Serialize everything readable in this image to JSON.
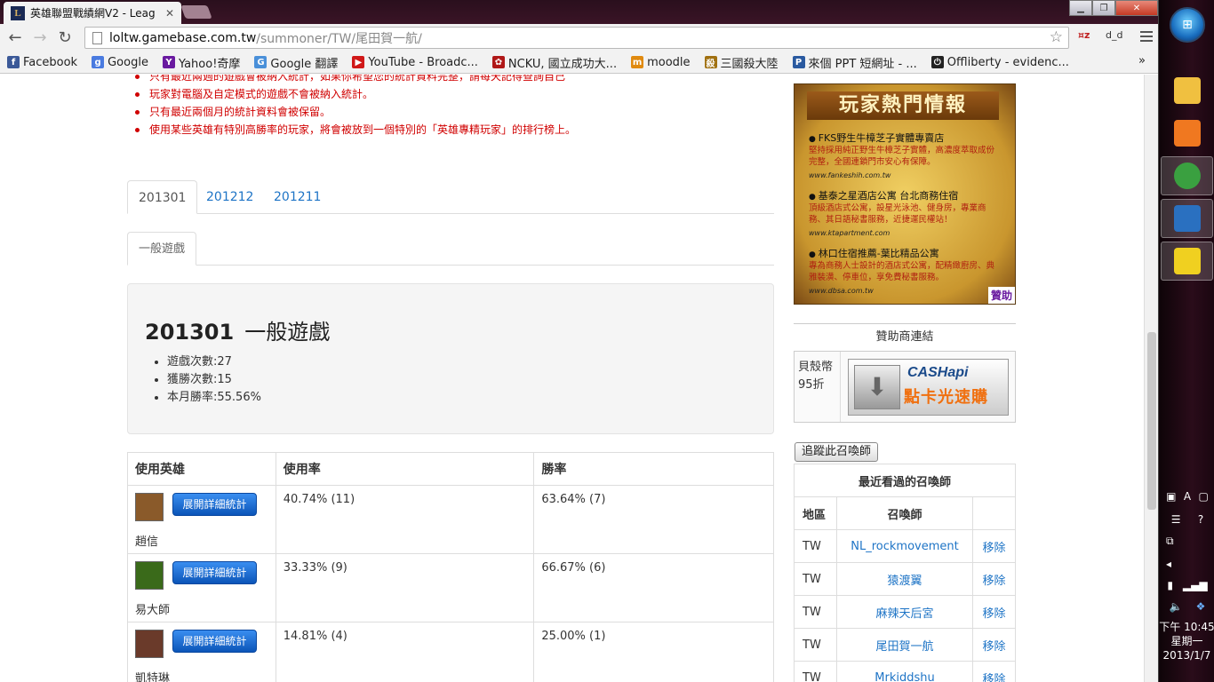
{
  "browser": {
    "tab_title": "英雄聯盟戰績網V2 - Leag",
    "tab_favicon": "L",
    "url_host": "loltw.gamebase.com.tw",
    "url_path": "/summoner/TW/尾田賀一航/",
    "ext_label": "d_d"
  },
  "bookmarks": [
    {
      "label": "Facebook",
      "icon": "f",
      "color": "#3b5998"
    },
    {
      "label": "Google",
      "icon": "g",
      "color": "#4a7be0"
    },
    {
      "label": "Yahoo!奇摩",
      "icon": "Y",
      "color": "#6a1aa0"
    },
    {
      "label": "Google 翻譯",
      "icon": "G",
      "color": "#4a90d9"
    },
    {
      "label": "YouTube - Broadc...",
      "icon": "▶",
      "color": "#d01818"
    },
    {
      "label": "NCKU, 國立成功大...",
      "icon": "✿",
      "color": "#b01818"
    },
    {
      "label": "moodle",
      "icon": "m",
      "color": "#e08a10"
    },
    {
      "label": "三國殺大陸",
      "icon": "殺",
      "color": "#a07010"
    },
    {
      "label": "來個 PPT 短網址 - ...",
      "icon": "P",
      "color": "#2a5aa0"
    },
    {
      "label": "Offliberty - evidenc...",
      "icon": "⏻",
      "color": "#222222"
    }
  ],
  "notes": [
    "只有最近兩週的遊戲會被納入統計，如果你希望您的統計資料完整，請每天記得查詢自己",
    "玩家對電腦及自定模式的遊戲不會被納入統計。",
    "只有最近兩個月的統計資料會被保留。",
    "使用某些英雄有特別高勝率的玩家，將會被放到一個特別的「英雄專精玩家」的排行榜上。"
  ],
  "month_tabs": [
    "201301",
    "201212",
    "201211"
  ],
  "mode_tabs": [
    "一般遊戲"
  ],
  "summary": {
    "month": "201301",
    "mode": "一般遊戲",
    "games": "遊戲次數:27",
    "wins": "獲勝次數:15",
    "winrate": "本月勝率:55.56%"
  },
  "stats": {
    "headers": [
      "使用英雄",
      "使用率",
      "勝率"
    ],
    "button_label": "展開詳細統計",
    "rows": [
      {
        "name": "趙信",
        "usage": "40.74%  (11)",
        "winrate": "63.64%  (7)",
        "avatar_color": "#8a5a2a"
      },
      {
        "name": "易大師",
        "usage": "33.33%  (9)",
        "winrate": "66.67%  (6)",
        "avatar_color": "#3a6a1a"
      },
      {
        "name": "凱特琳",
        "usage": "14.81%  (4)",
        "winrate": "25.00%  (1)",
        "avatar_color": "#6a3a2a"
      }
    ]
  },
  "ad": {
    "title": "玩家熱門情報",
    "items": [
      {
        "title": "FKS野生牛樟芝子實體專賣店",
        "desc": "堅持採用純正野生牛樟芝子實體，高濃度萃取成份完整，全國連鎖門市安心有保障。",
        "url": "www.fankeshih.com.tw"
      },
      {
        "title": "基泰之星酒店公寓 台北商務住宿",
        "desc": "頂級酒店式公寓，設星光泳池、健身房，專業商務、其日語秘書服務，近捷運民權站！",
        "url": "www.ktapartment.com"
      },
      {
        "title": "林口住宿推薦-葉比精品公寓",
        "desc": "專為商務人士設計的酒店式公寓，配精緻廚房、典雅裝潢、停車位，享免費秘書服務。",
        "url": "www.dbsa.com.tw"
      }
    ],
    "sponsor": "贊助"
  },
  "sidebar": {
    "sponsor_links": "贊助商連結",
    "cash_text": "貝殼幣95折",
    "cash_logo": "CASHapi",
    "cash_slogan": "點卡光速購",
    "follow_button": "追蹤此召喚師"
  },
  "recent": {
    "caption": "最近看過的召喚師",
    "headers": [
      "地區",
      "召喚師"
    ],
    "remove_label": "移除",
    "rows": [
      {
        "region": "TW",
        "name": "NL_rockmovement"
      },
      {
        "region": "TW",
        "name": "猿渡翼"
      },
      {
        "region": "TW",
        "name": "麻辣天后宮"
      },
      {
        "region": "TW",
        "name": "尾田賀一航"
      },
      {
        "region": "TW",
        "name": "Mrkiddshu"
      }
    ]
  },
  "taskbar": {
    "time": "下午 10:45",
    "day": "星期一",
    "date": "2013/1/7",
    "apps": [
      {
        "name": "file-explorer",
        "color": "#f0c040"
      },
      {
        "name": "media-player",
        "color": "#f07820"
      },
      {
        "name": "chrome",
        "color": "#3aa040"
      },
      {
        "name": "skype-like",
        "color": "#2a70c0"
      },
      {
        "name": "app-yellow",
        "color": "#f0d020"
      }
    ]
  }
}
